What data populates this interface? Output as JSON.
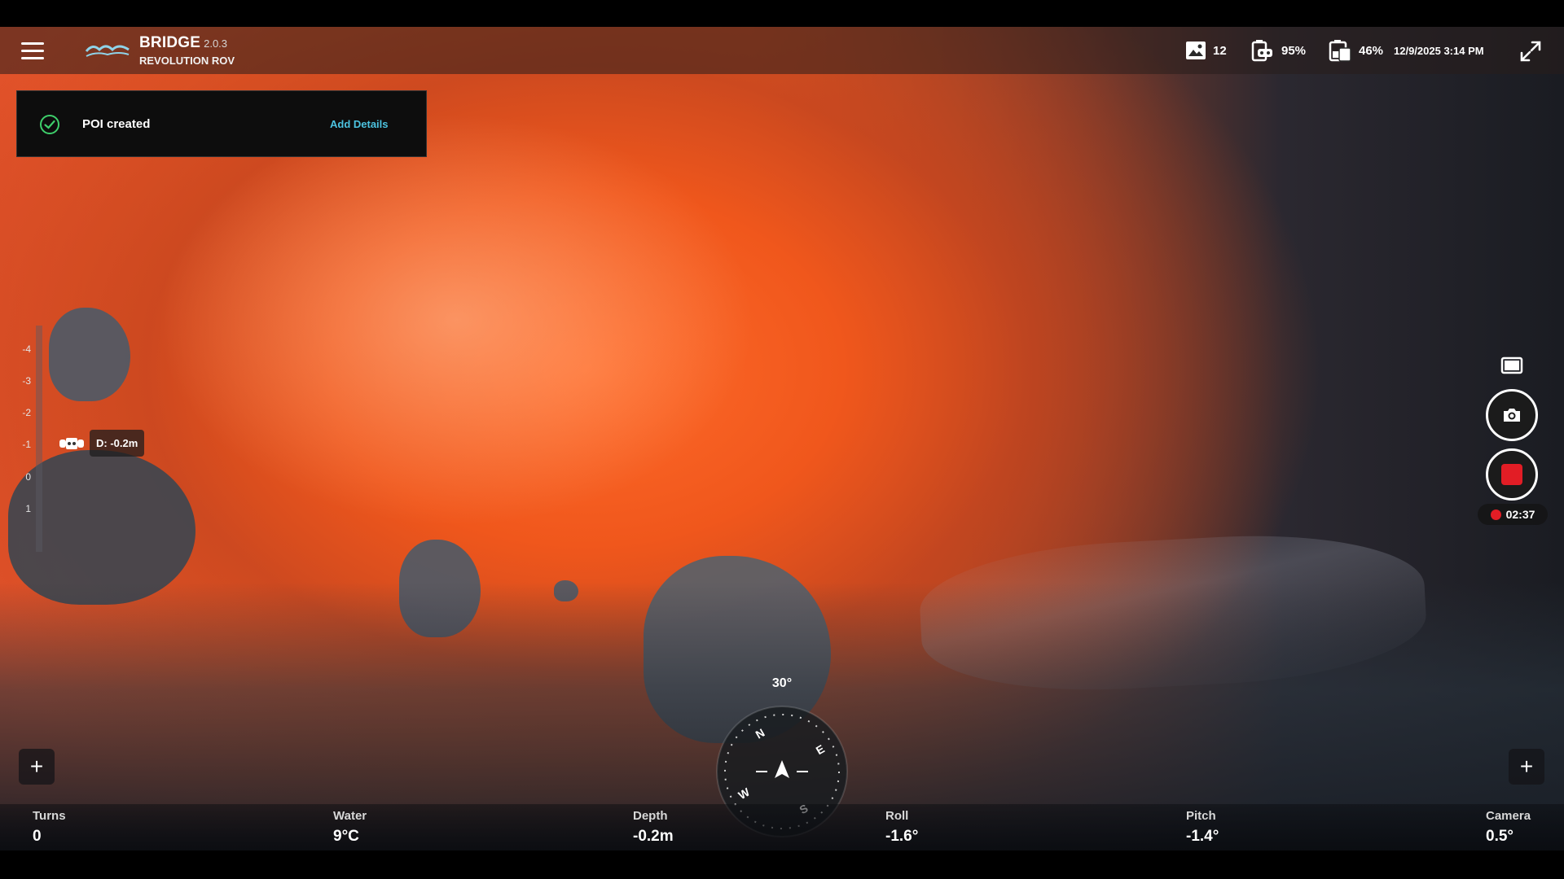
{
  "app": {
    "name": "BRIDGE",
    "version": "2.0.3",
    "subtitle": "REVOLUTION ROV"
  },
  "status": {
    "photo_count": "12",
    "rov_battery": "95%",
    "tablet_battery": "46%",
    "datetime": "12/9/2025 3:14 PM"
  },
  "toast": {
    "message": "POI created",
    "action": "Add Details"
  },
  "depth_scale": {
    "ticks": [
      "-4",
      "-3",
      "-2",
      "-1",
      "0",
      "1"
    ],
    "marker_label": "D: -0.2m"
  },
  "recording": {
    "timer": "02:37"
  },
  "compass": {
    "heading": "30°",
    "cardinals": {
      "n": "N",
      "e": "E",
      "s": "S",
      "w": "W"
    }
  },
  "telemetry": {
    "turns": {
      "label": "Turns",
      "value": "0"
    },
    "water": {
      "label": "Water",
      "value": "9°C"
    },
    "depth": {
      "label": "Depth",
      "value": "-0.2m"
    },
    "roll": {
      "label": "Roll",
      "value": "-1.6°"
    },
    "pitch": {
      "label": "Pitch",
      "value": "-1.4°"
    },
    "camera": {
      "label": "Camera",
      "value": "0.5°"
    }
  },
  "colors": {
    "accent": "#4cc3e0",
    "record": "#e21d25",
    "success": "#3ecf6b"
  },
  "icons": {
    "menu": "menu-icon",
    "photos": "image-icon",
    "rov_battery": "rov-battery-icon",
    "tablet_battery": "tablet-battery-icon",
    "expand": "expand-icon",
    "camera": "camera-icon",
    "record": "stop-record-icon",
    "layout": "layout-icon",
    "add": "plus-icon"
  }
}
